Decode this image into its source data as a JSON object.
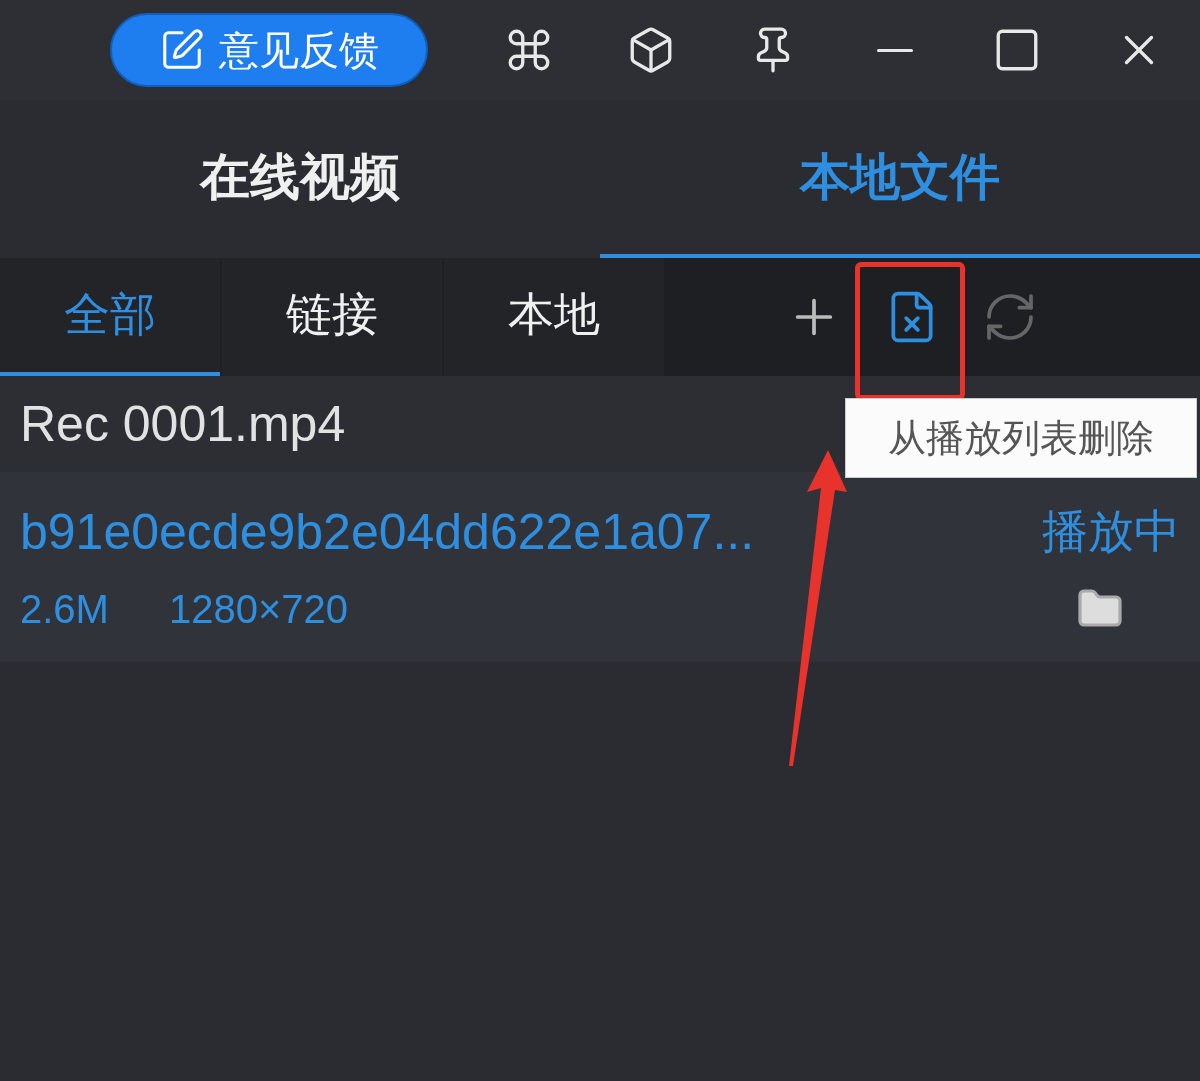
{
  "toolbar": {
    "feedback_button": "意见反馈"
  },
  "main_tabs": [
    {
      "label": "在线视频",
      "selected": false
    },
    {
      "label": "本地文件",
      "selected": true
    }
  ],
  "sub_tabs": [
    {
      "label": "全部",
      "selected": true
    },
    {
      "label": "链接",
      "selected": false
    },
    {
      "label": "本地",
      "selected": false
    }
  ],
  "tooltip": "从播放列表删除",
  "playlist": [
    {
      "name": "Rec 0001.mp4",
      "playing": false
    },
    {
      "name": "b91e0ecde9b2e04dd622e1a07...",
      "playing": true,
      "status": "播放中",
      "size": "2.6M",
      "resolution": "1280×720"
    }
  ]
}
